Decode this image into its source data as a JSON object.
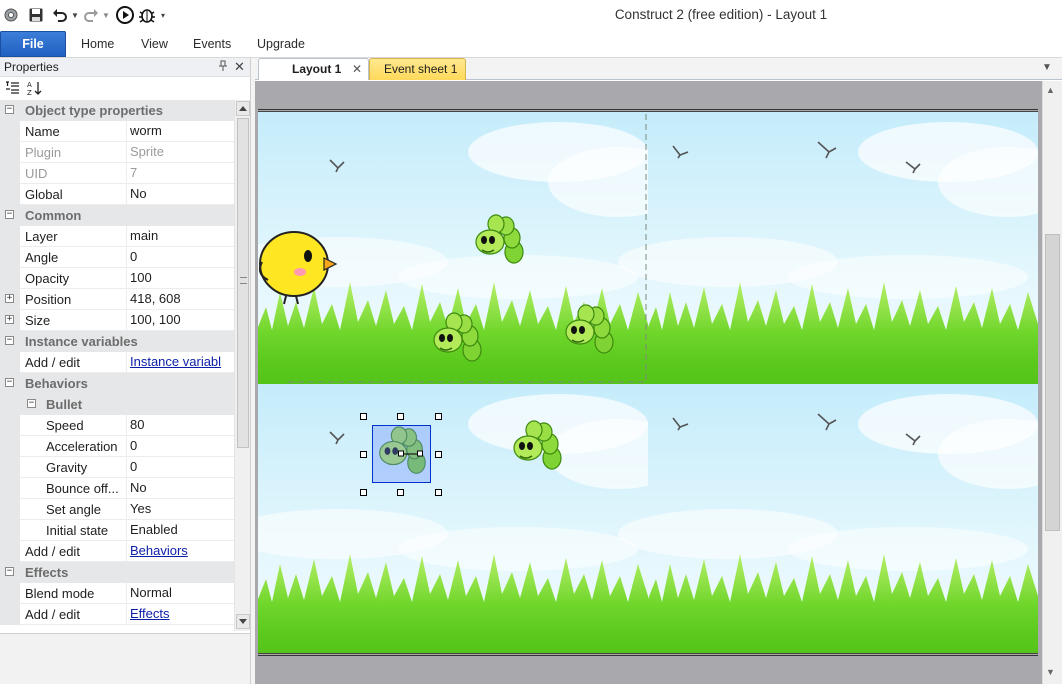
{
  "titlebar": {
    "title": "Construct 2  (free edition) - Layout 1",
    "icons": [
      "app-gear-icon",
      "save-icon",
      "undo-icon",
      "redo-icon",
      "run-icon",
      "debug-icon",
      "customize-icon"
    ]
  },
  "ribbon": {
    "tabs": [
      "File",
      "Home",
      "View",
      "Events",
      "Upgrade"
    ]
  },
  "properties": {
    "panel_title": "Properties",
    "rows": [
      {
        "kind": "category",
        "name": "Object type properties"
      },
      {
        "kind": "prop",
        "name": "Name",
        "value": "worm"
      },
      {
        "kind": "prop",
        "name": "Plugin",
        "value": "Sprite",
        "dim": true
      },
      {
        "kind": "prop",
        "name": "UID",
        "value": "7",
        "dim": true
      },
      {
        "kind": "prop",
        "name": "Global",
        "value": "No"
      },
      {
        "kind": "category",
        "name": "Common"
      },
      {
        "kind": "prop",
        "name": "Layer",
        "value": "main"
      },
      {
        "kind": "prop",
        "name": "Angle",
        "value": "0"
      },
      {
        "kind": "prop",
        "name": "Opacity",
        "value": "100"
      },
      {
        "kind": "prop",
        "name": "Position",
        "value": "418, 608",
        "expander": "+"
      },
      {
        "kind": "prop",
        "name": "Size",
        "value": "100, 100",
        "expander": "+"
      },
      {
        "kind": "category",
        "name": "Instance variables"
      },
      {
        "kind": "prop",
        "name": "Add / edit",
        "value": "Instance variabl",
        "link": true
      },
      {
        "kind": "category",
        "name": "Behaviors"
      },
      {
        "kind": "subcategory",
        "name": "Bullet"
      },
      {
        "kind": "subprop",
        "name": "Speed",
        "value": "80"
      },
      {
        "kind": "subprop",
        "name": "Acceleration",
        "value": "0"
      },
      {
        "kind": "subprop",
        "name": "Gravity",
        "value": "0"
      },
      {
        "kind": "subprop",
        "name": "Bounce off...",
        "value": "No"
      },
      {
        "kind": "subprop",
        "name": "Set angle",
        "value": "Yes"
      },
      {
        "kind": "subprop",
        "name": "Initial state",
        "value": "Enabled"
      },
      {
        "kind": "prop",
        "name": "Add / edit",
        "value": "Behaviors",
        "link": true
      },
      {
        "kind": "category",
        "name": "Effects"
      },
      {
        "kind": "prop",
        "name": "Blend mode",
        "value": "Normal"
      },
      {
        "kind": "prop",
        "name": "Add / edit",
        "value": "Effects",
        "link": true
      }
    ]
  },
  "documents": {
    "tabs": [
      {
        "label": "Layout 1",
        "active": true
      },
      {
        "label": "Event sheet 1",
        "active": false
      }
    ]
  },
  "colors": {
    "file_tab": "#2a6ccb",
    "event_tab": "#ffdf6e",
    "sky": "#cfeefa",
    "grass": "#6fd62a",
    "canvas_margin": "#a9a9ad"
  }
}
